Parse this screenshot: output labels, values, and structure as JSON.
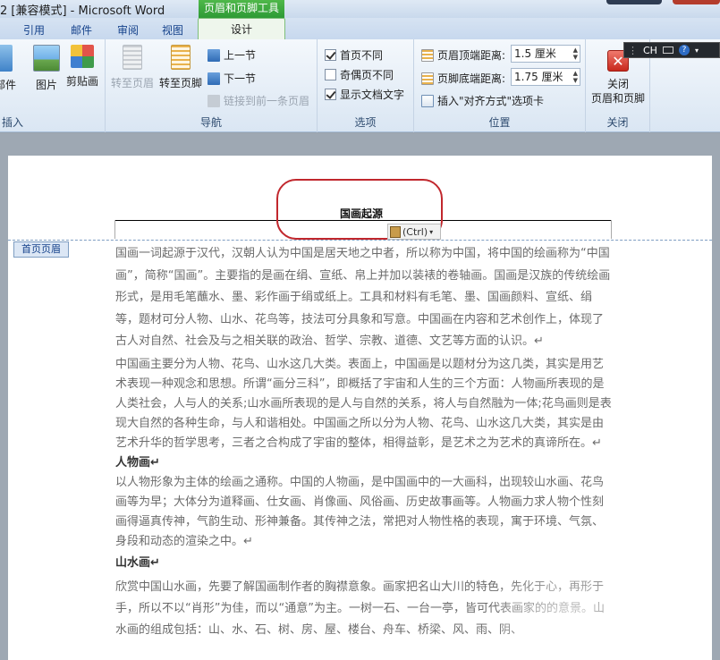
{
  "titlebar": {
    "title": "2 [兼容模式] - Microsoft Word",
    "context_tab_title": "页眉和页脚工具"
  },
  "tabs": [
    "引用",
    "邮件",
    "审阅",
    "视图"
  ],
  "active_tab": "设计",
  "ribbon": {
    "insert_group": {
      "label": "插入",
      "buttons": [
        "部件",
        "图片",
        "剪贴画"
      ]
    },
    "nav_group": {
      "label": "导航",
      "goto_header": "转至页眉",
      "goto_footer": "转至页脚",
      "prev_section": "上一节",
      "next_section": "下一节",
      "link_prev": "链接到前一条页眉"
    },
    "options_group": {
      "label": "选项",
      "first_page_diff": "首页不同",
      "odd_even_diff": "奇偶页不同",
      "show_doc_text": "显示文档文字"
    },
    "position_group": {
      "label": "位置",
      "header_top_label": "页眉顶端距离:",
      "header_top_value": "1.5 厘米",
      "footer_bottom_label": "页脚底端距离:",
      "footer_bottom_value": "1.75 厘米",
      "insert_align_tab": "插入\"对齐方式\"选项卡"
    },
    "close_group": {
      "label": "关闭",
      "close_button_line1": "关闭",
      "close_button_line2": "页眉和页脚"
    }
  },
  "langbar": {
    "text": "CH"
  },
  "document": {
    "header_text": "国画起源",
    "paste_tag": "(Ctrl)",
    "header_label": "首页页眉",
    "paragraphs": [
      "国画一词起源于汉代，汉朝人认为中国是居天地之中者，所以称为中国，将中国的绘画称为“中国画”，简称“国画”。主要指的是画在绢、宣纸、帛上并加以装裱的卷轴画。国画是汉族的传统绘画形式，是用毛笔蘸水、墨、彩作画于绢或纸上。工具和材料有毛笔、墨、国画颜料、宣纸、绢等，题材可分人物、山水、花鸟等，技法可分具象和写意。中国画在内容和艺术创作上，体现了古人对自然、社会及与之相关联的政治、哲学、宗教、道德、文艺等方面的认识。↵",
      "中国画主要分为人物、花鸟、山水这几大类。表面上，中国画是以题材分为这几类，其实是用艺术表现一种观念和思想。所谓“画分三科”，即概括了宇宙和人生的三个方面：人物画所表现的是人类社会，人与人的关系;山水画所表现的是人与自然的关系，将人与自然融为一体;花鸟画则是表现大自然的各种生命，与人和谐相处。中国画之所以分为人物、花鸟、山水这几大类，其实是由艺术升华的哲学思考，三者之合构成了宇宙的整体，相得益彰，是艺术之为艺术的真谛所在。↵"
    ],
    "heading1": "人物画↵",
    "paragraph3": "以人物形象为主体的绘画之通称。中国的人物画，是中国画中的一大画科，出现较山水画、花鸟画等为早；大体分为道释画、仕女画、肖像画、风俗画、历史故事画等。人物画力求人物个性刻画得逼真传神，气韵生动、形神兼备。其传神之法，常把对人物性格的表现，寓于环境、气氛、身段和动态的渲染之中。↵",
    "heading2": "山水画↵",
    "paragraph4": "欣赏中国山水画，先要了解国画制作者的胸襟意象。画家把名山大川的特色，先化于心，再形于手，所以不以“肖形”为佳，而以“通意”为主。一树一石、一台一亭，皆可代表画家的的意景。山水画的组成包括：山、水、石、树、房、屋、楼台、舟车、桥梁、风、雨、阴、"
  },
  "colors": {
    "highlight_ellipse": "#c1272d",
    "context_tab_green": "#2e9a36",
    "ribbon_label": "#2d4a6e"
  }
}
